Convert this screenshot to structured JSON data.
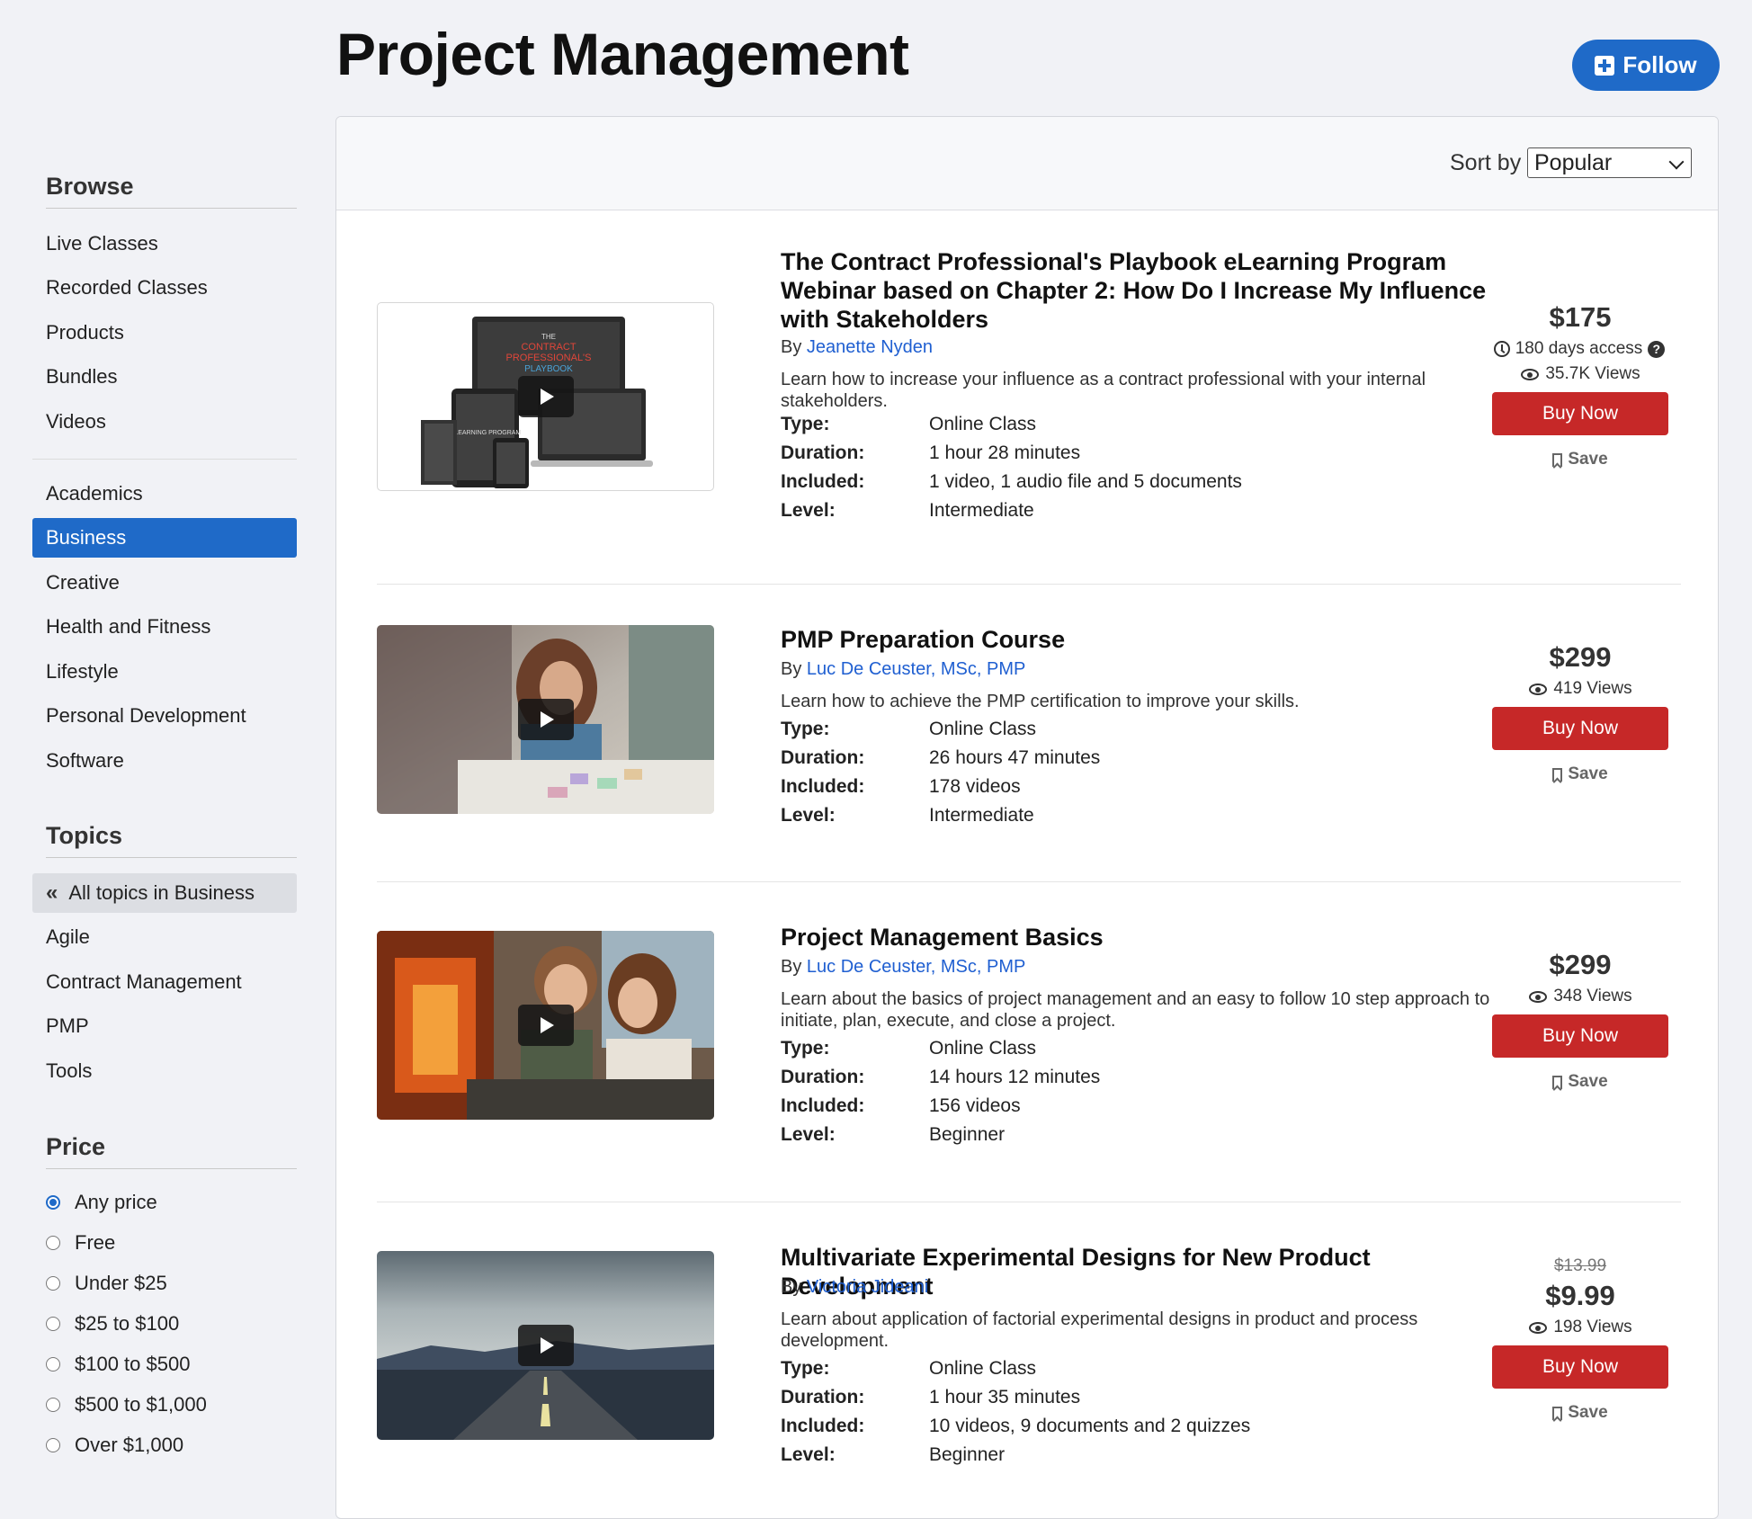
{
  "page": {
    "title": "Project Management",
    "follow_label": "Follow"
  },
  "sidebar": {
    "browse_heading": "Browse",
    "browse_items": [
      "Live Classes",
      "Recorded Classes",
      "Products",
      "Bundles",
      "Videos"
    ],
    "categories": [
      "Academics",
      "Business",
      "Creative",
      "Health and Fitness",
      "Lifestyle",
      "Personal Development",
      "Software"
    ],
    "active_category": "Business",
    "topics_heading": "Topics",
    "all_topics_label": "All topics in Business",
    "topics": [
      "Agile",
      "Contract Management",
      "PMP",
      "Tools"
    ],
    "price_heading": "Price",
    "price_options": [
      "Any price",
      "Free",
      "Under $25",
      "$25 to $100",
      "$100 to $500",
      "$500 to $1,000",
      "Over $1,000"
    ],
    "price_selected": "Any price"
  },
  "sort": {
    "label": "Sort by",
    "selected": "Popular"
  },
  "spec_labels": {
    "type": "Type:",
    "duration": "Duration:",
    "included": "Included:",
    "level": "Level:"
  },
  "by_label": "By",
  "buy_label": "Buy Now",
  "save_label": "Save",
  "courses": [
    {
      "title": "The Contract Professional's Playbook eLearning Program Webinar based on Chapter 2: How Do I Increase My Influence with Stakeholders",
      "author": "Jeanette Nyden",
      "description": "Learn how to increase your influence as a contract professional with your internal stakeholders.",
      "type": "Online Class",
      "duration": "1 hour 28 minutes",
      "included": "1 video, 1 audio file and 5 documents",
      "level": "Intermediate",
      "price": "$175",
      "access": "180 days access",
      "views": "35.7K Views",
      "thumb_text": [
        "THE",
        "CONTRACT",
        "PROFESSIONAL'S",
        "PLAYBOOK",
        "ELEARNING PROGRAM"
      ]
    },
    {
      "title": "PMP Preparation Course",
      "author": "Luc De Ceuster, MSc, PMP",
      "description": "Learn how to achieve the PMP certification to improve your skills.",
      "type": "Online Class",
      "duration": "26 hours 47 minutes",
      "included": "178 videos",
      "level": "Intermediate",
      "price": "$299",
      "views": "419 Views"
    },
    {
      "title": "Project Management Basics",
      "author": "Luc De Ceuster, MSc, PMP",
      "description": "Learn about the basics of project management and an easy to follow 10 step approach to initiate, plan, execute, and close a project.",
      "type": "Online Class",
      "duration": "14 hours 12 minutes",
      "included": "156 videos",
      "level": "Beginner",
      "price": "$299",
      "views": "348 Views"
    },
    {
      "title": "Multivariate Experimental Designs for New Product Development",
      "author": "Victoria Jideani",
      "description": "Learn about application of factorial experimental designs in product and process development.",
      "type": "Online Class",
      "duration": "1 hour 35 minutes",
      "included": "10 videos, 9 documents and 2 quizzes",
      "level": "Beginner",
      "old_price": "$13.99",
      "price": "$9.99",
      "views": "198 Views"
    }
  ],
  "colors": {
    "accent": "#1f6ac8",
    "buy": "#c62828",
    "link": "#1f5fd1",
    "background": "#f1f2f6"
  }
}
